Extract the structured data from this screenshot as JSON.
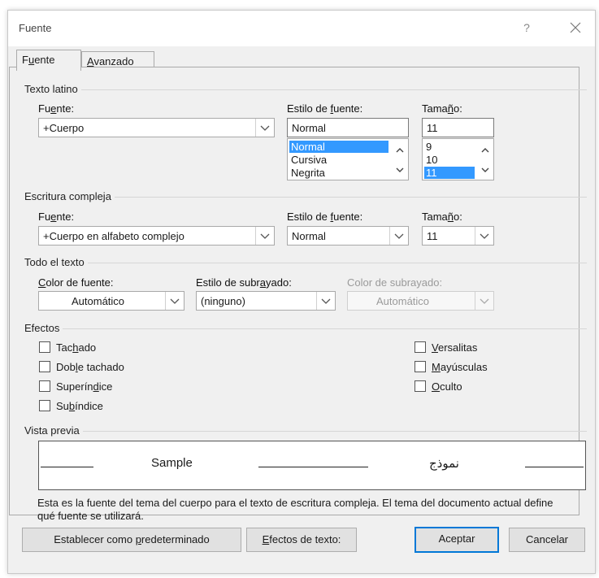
{
  "window": {
    "title": "Fuente",
    "help_glyph": "?",
    "close_icon": "close-icon"
  },
  "tabs": [
    {
      "label_pre": "F",
      "label_u": "u",
      "label_post": "ente"
    },
    {
      "label_pre": "",
      "label_u": "A",
      "label_post": "vanzado"
    }
  ],
  "latin": {
    "section": "Texto latino",
    "font_label_pre": "Fu",
    "font_label_u": "e",
    "font_label_post": "nte:",
    "font_value": "+Cuerpo",
    "style_label_pre": "Estilo de ",
    "style_label_u": "f",
    "style_label_post": "uente:",
    "style_value": "Normal",
    "style_options": [
      "Normal",
      "Cursiva",
      "Negrita"
    ],
    "size_label_pre": "Tama",
    "size_label_u": "ñ",
    "size_label_post": "o:",
    "size_value": "11",
    "size_options": [
      "9",
      "10",
      "11"
    ]
  },
  "complex": {
    "section": "Escritura compleja",
    "font_label_pre": "Fu",
    "font_label_u": "e",
    "font_label_post": "nte:",
    "font_value": "+Cuerpo en alfabeto complejo",
    "style_label_pre": "Estilo de ",
    "style_label_u": "f",
    "style_label_post": "uente:",
    "style_value": "Normal",
    "size_label_pre": "Tama",
    "size_label_u": "ñ",
    "size_label_post": "o:",
    "size_value": "11"
  },
  "all_text": {
    "section": "Todo el texto",
    "color_label_pre": "",
    "color_label_u": "C",
    "color_label_post": "olor de fuente:",
    "color_value": "Automático",
    "underline_label_pre": "Estilo de subr",
    "underline_label_u": "a",
    "underline_label_post": "yado:",
    "underline_value": "(ninguno)",
    "underline_color_label": "Color de subrayado:",
    "underline_color_value": "Automático"
  },
  "effects": {
    "section": "Efectos",
    "left": [
      {
        "pre": "Tac",
        "u": "h",
        "post": "ado"
      },
      {
        "pre": "Dob",
        "u": "l",
        "post": "e tachado"
      },
      {
        "pre": "Superín",
        "u": "d",
        "post": "ice"
      },
      {
        "pre": "Su",
        "u": "b",
        "post": "índice"
      }
    ],
    "right": [
      {
        "pre": "",
        "u": "V",
        "post": "ersalitas"
      },
      {
        "pre": "",
        "u": "M",
        "post": "ayúsculas"
      },
      {
        "pre": "",
        "u": "O",
        "post": "culto"
      }
    ]
  },
  "preview": {
    "section": "Vista previa",
    "sample_latin": "Sample",
    "sample_complex": "نموذج",
    "description": "Esta es la fuente del tema del cuerpo para el texto de escritura compleja. El tema del documento actual define qué fuente se utilizará."
  },
  "buttons": {
    "default_pre": "Establecer como ",
    "default_u": "p",
    "default_post": "redeterminado",
    "text_effects_pre": "",
    "text_effects_u": "E",
    "text_effects_post": "fectos de texto:",
    "ok": "Aceptar",
    "cancel": "Cancelar"
  },
  "colors": {
    "selection": "#3399ff",
    "primary_border": "#0078d7",
    "dialog_bg": "#f0f0f0"
  }
}
